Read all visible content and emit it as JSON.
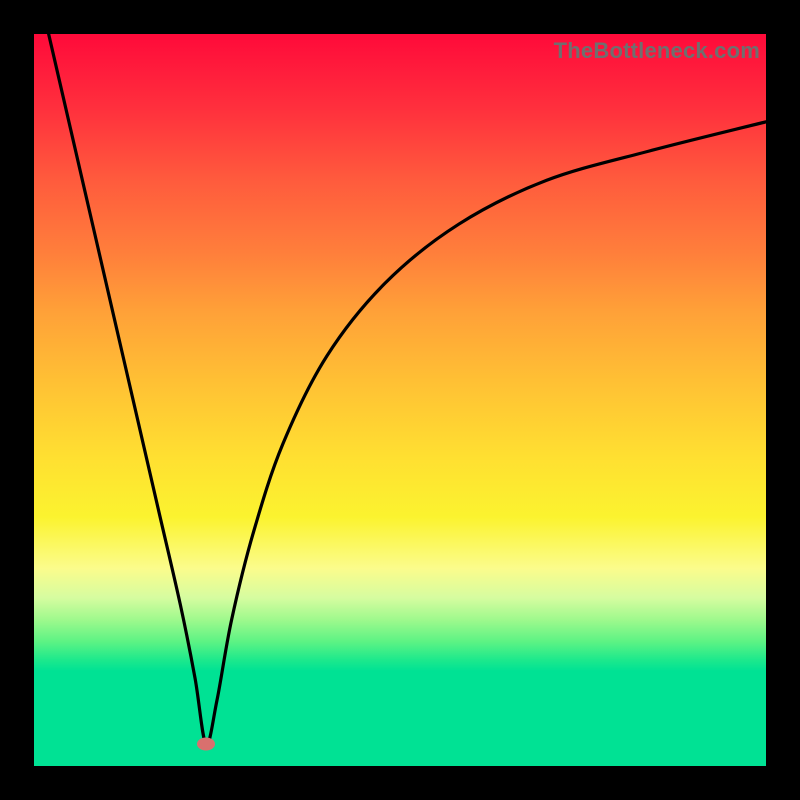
{
  "watermark": "TheBottleneck.com",
  "chart_data": {
    "type": "line",
    "title": "",
    "xlabel": "",
    "ylabel": "",
    "xlim": [
      0,
      100
    ],
    "ylim": [
      0,
      100
    ],
    "grid": false,
    "legend": false,
    "background_gradient": {
      "direction": "vertical",
      "stops": [
        {
          "pos": 0,
          "color": "#ff0a3a"
        },
        {
          "pos": 30,
          "color": "#ff7f3b"
        },
        {
          "pos": 58,
          "color": "#ffe031"
        },
        {
          "pos": 73,
          "color": "#fbfc8c"
        },
        {
          "pos": 87,
          "color": "#00e294"
        },
        {
          "pos": 100,
          "color": "#00e294"
        }
      ]
    },
    "series": [
      {
        "name": "bottleneck-curve",
        "description": "V-shaped curve: steep left arm descending to a minimum near x≈24, right arm rising with decreasing slope toward an asymptote",
        "x": [
          2,
          5,
          8,
          11,
          14,
          17,
          20,
          22,
          23.5,
          25,
          27,
          30,
          34,
          40,
          48,
          58,
          70,
          84,
          100
        ],
        "y": [
          100,
          87,
          74,
          61,
          48,
          35,
          22,
          12,
          3,
          9,
          20,
          32,
          44,
          56,
          66,
          74,
          80,
          84,
          88
        ]
      }
    ],
    "marker": {
      "name": "optimal-point",
      "x": 23.5,
      "y": 3,
      "color": "#d9706e"
    }
  }
}
